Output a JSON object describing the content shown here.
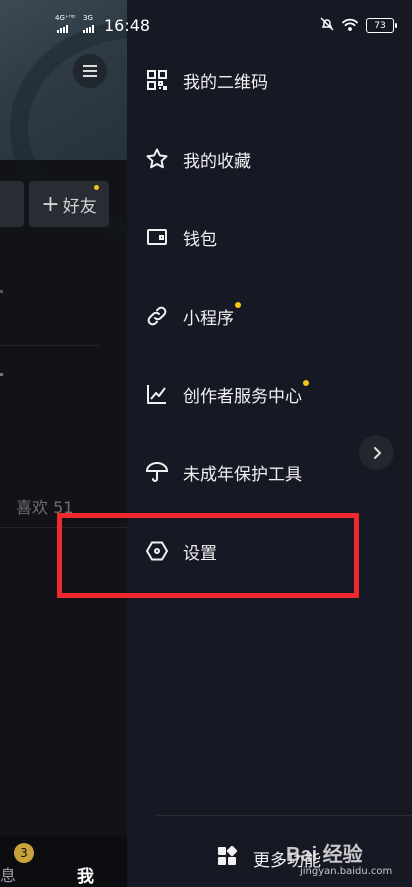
{
  "status_bar": {
    "network_1": "4G⁺ᴴᴰ",
    "network_2": "3G",
    "time": "16:48",
    "battery": "73"
  },
  "background_page": {
    "add_friend_label": "好友",
    "likes_label": "喜欢 51",
    "nav_messages_label": "息",
    "nav_messages_badge": "3",
    "nav_me_label": "我"
  },
  "drawer": {
    "items": [
      {
        "label": "我的二维码",
        "icon": "qr-code-icon",
        "dot": false
      },
      {
        "label": "我的收藏",
        "icon": "star-icon",
        "dot": false
      },
      {
        "label": "钱包",
        "icon": "wallet-icon",
        "dot": false
      },
      {
        "label": "小程序",
        "icon": "link-icon",
        "dot": true
      },
      {
        "label": "创作者服务中心",
        "icon": "chart-icon",
        "dot": true
      },
      {
        "label": "未成年保护工具",
        "icon": "umbrella-icon",
        "dot": false
      },
      {
        "label": "设置",
        "icon": "hexagon-gear-icon",
        "dot": false
      }
    ],
    "more_label": "更多功能"
  },
  "watermark": {
    "main": "Bai 经验",
    "sub": "jingyan.baidu.com"
  },
  "colors": {
    "drawer_bg": "#161823",
    "highlight_red": "#ee2a2f",
    "dot_yellow": "#f5c518"
  }
}
